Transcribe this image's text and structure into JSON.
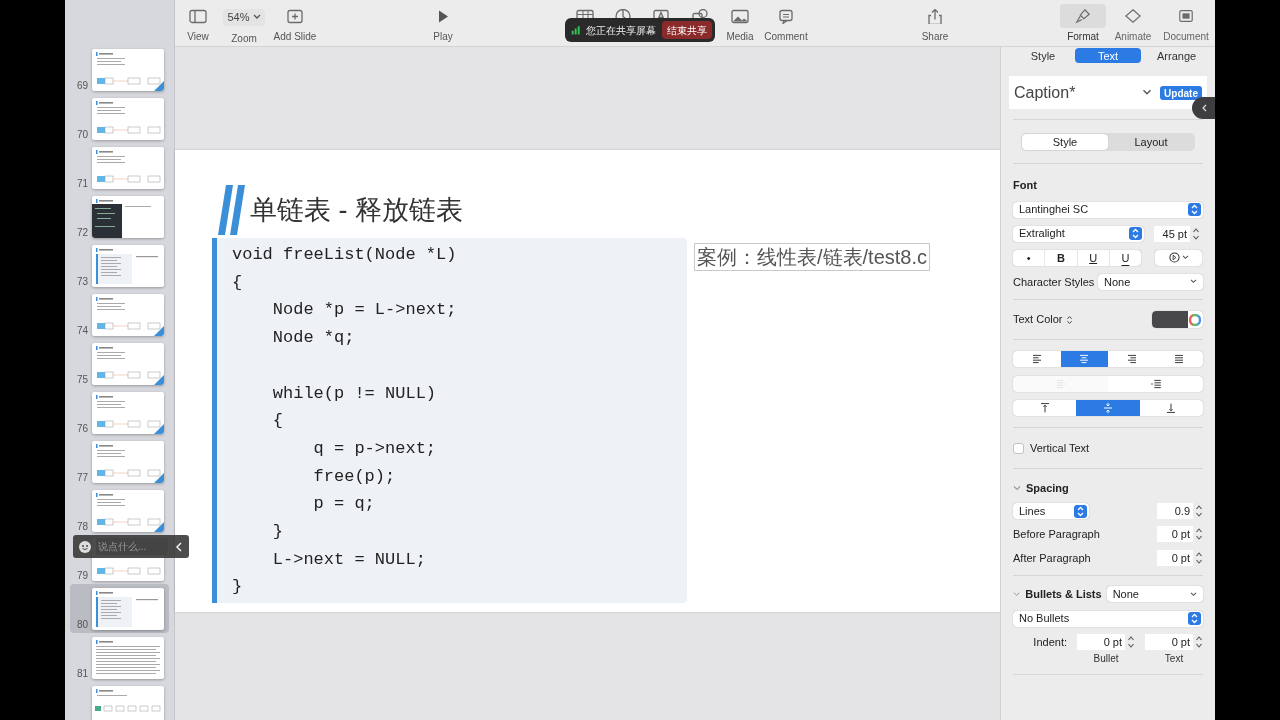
{
  "toolbar": {
    "items": [
      {
        "kind": "view",
        "label": "View"
      },
      {
        "kind": "zoom",
        "value": "54%",
        "label": "Zoom"
      },
      {
        "kind": "add-slide",
        "label": "Add Slide"
      },
      {
        "kind": "play",
        "label": "Play"
      },
      {
        "kind": "table"
      },
      {
        "kind": "chart"
      },
      {
        "kind": "text"
      },
      {
        "kind": "shape"
      },
      {
        "kind": "media",
        "label": "Media"
      },
      {
        "kind": "comment",
        "label": "Comment"
      },
      {
        "kind": "share",
        "label": "Share"
      }
    ],
    "inspector_tabs": [
      {
        "kind": "format",
        "label": "Format",
        "selected": true
      },
      {
        "kind": "animate",
        "label": "Animate",
        "selected": false
      },
      {
        "kind": "document",
        "label": "Document",
        "selected": false
      }
    ]
  },
  "screen_share_bar": {
    "message": "您正在共享屏幕",
    "button": "结束共享"
  },
  "sidebar": {
    "slides": [
      {
        "number": "69",
        "kind": "diagram",
        "selected": false
      },
      {
        "number": "70",
        "kind": "flow",
        "selected": false
      },
      {
        "number": "71",
        "kind": "flow",
        "selected": false
      },
      {
        "number": "72",
        "kind": "dark-code",
        "selected": false
      },
      {
        "number": "73",
        "kind": "code",
        "selected": false
      },
      {
        "number": "74",
        "kind": "diagram",
        "selected": false
      },
      {
        "number": "75",
        "kind": "diagram",
        "selected": false
      },
      {
        "number": "76",
        "kind": "diagram",
        "selected": false
      },
      {
        "number": "77",
        "kind": "diagram",
        "selected": false
      },
      {
        "number": "78",
        "kind": "diagram",
        "selected": false
      },
      {
        "number": "79",
        "kind": "flow",
        "selected": false
      },
      {
        "number": "80",
        "kind": "code",
        "selected": true
      },
      {
        "number": "81",
        "kind": "text",
        "selected": false
      },
      {
        "kind": "nodes",
        "selected": false
      }
    ]
  },
  "comment_overlay": {
    "placeholder": "说点什么..."
  },
  "slide": {
    "title": "单链表 - 释放链表",
    "code": "void freeList(Node *L)\n{\n    Node *p = L->next;\n    Node *q;\n\n    while(p != NULL)\n    {\n        q = p->next;\n        free(p);\n        p = q;\n    }\n    L->next = NULL;\n}",
    "caption": "案例：线性表/链表/test8.c"
  },
  "format_panel": {
    "tabs": [
      {
        "label": "Style",
        "selected": false
      },
      {
        "label": "Text",
        "selected": true
      },
      {
        "label": "Arrange",
        "selected": false
      }
    ],
    "paragraph_style": {
      "value": "Caption*",
      "button": "Update"
    },
    "segments": [
      {
        "label": "Style",
        "selected": true
      },
      {
        "label": "Layout",
        "selected": false
      }
    ],
    "font": {
      "label": "Font",
      "family": "Lantinghei SC",
      "typeface": "Extralight",
      "size": "45 pt",
      "style_buttons": [
        {
          "kind": "plain",
          "label": "•"
        },
        {
          "kind": "bold",
          "label": "B"
        },
        {
          "kind": "underline",
          "label": "U"
        },
        {
          "kind": "underline-low",
          "label": "U"
        }
      ]
    },
    "character_styles": {
      "label": "Character Styles",
      "value": "None"
    },
    "text_color": {
      "label": "Text Color",
      "color": "#48484a"
    },
    "alignment": [
      {
        "kind": "left",
        "selected": false
      },
      {
        "kind": "center",
        "selected": true
      },
      {
        "kind": "right",
        "selected": false
      },
      {
        "kind": "justify",
        "selected": false
      }
    ],
    "indent": [
      {
        "kind": "decrease",
        "disabled": true
      },
      {
        "kind": "increase",
        "disabled": false
      }
    ],
    "vertical_alignment": [
      {
        "kind": "top",
        "selected": false
      },
      {
        "kind": "middle",
        "selected": true
      },
      {
        "kind": "bottom",
        "selected": false
      }
    ],
    "vertical_text": {
      "label": "Vertical Text",
      "checked": false
    },
    "spacing": {
      "label": "Spacing",
      "expanded": true,
      "mode": "Lines",
      "value": "0.9",
      "before_label": "Before Paragraph",
      "before": "0 pt",
      "after_label": "After Paragraph",
      "after": "0 pt"
    },
    "bullets": {
      "label": "Bullets & Lists",
      "expanded": true,
      "value": "None",
      "type": "No Bullets",
      "indent_label": "Indent:",
      "bullet_indent": "0 pt",
      "bullet_caption": "Bullet",
      "text_indent": "0 pt",
      "text_caption": "Text"
    }
  }
}
